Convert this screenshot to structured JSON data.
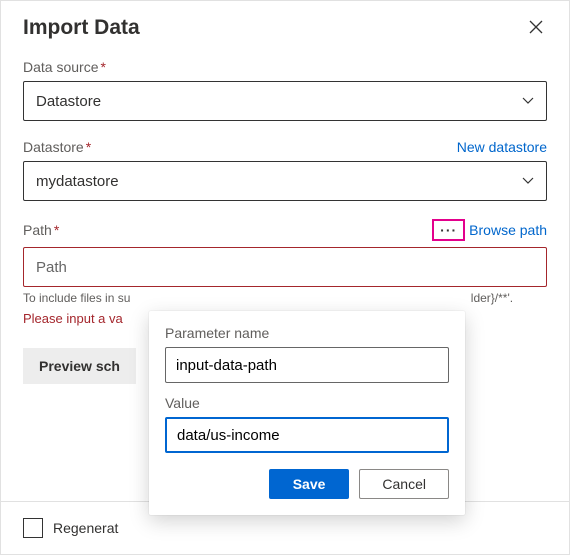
{
  "header": {
    "title": "Import Data"
  },
  "data_source": {
    "label": "Data source",
    "value": "Datastore"
  },
  "datastore": {
    "label": "Datastore",
    "new_link": "New datastore",
    "value": "mydatastore"
  },
  "path": {
    "label": "Path",
    "browse_link": "Browse path",
    "placeholder": "Path",
    "value": "",
    "hint_prefix": "To include files in su",
    "hint_suffix": "lder}/**'.",
    "error_text": "Please input a va"
  },
  "preview": {
    "label": "Preview sch"
  },
  "footer": {
    "regenerate_label": "Regenerat"
  },
  "popover": {
    "param_label": "Parameter name",
    "param_value": "input-data-path",
    "value_label": "Value",
    "value_value": "data/us-income",
    "save_label": "Save",
    "cancel_label": "Cancel"
  }
}
